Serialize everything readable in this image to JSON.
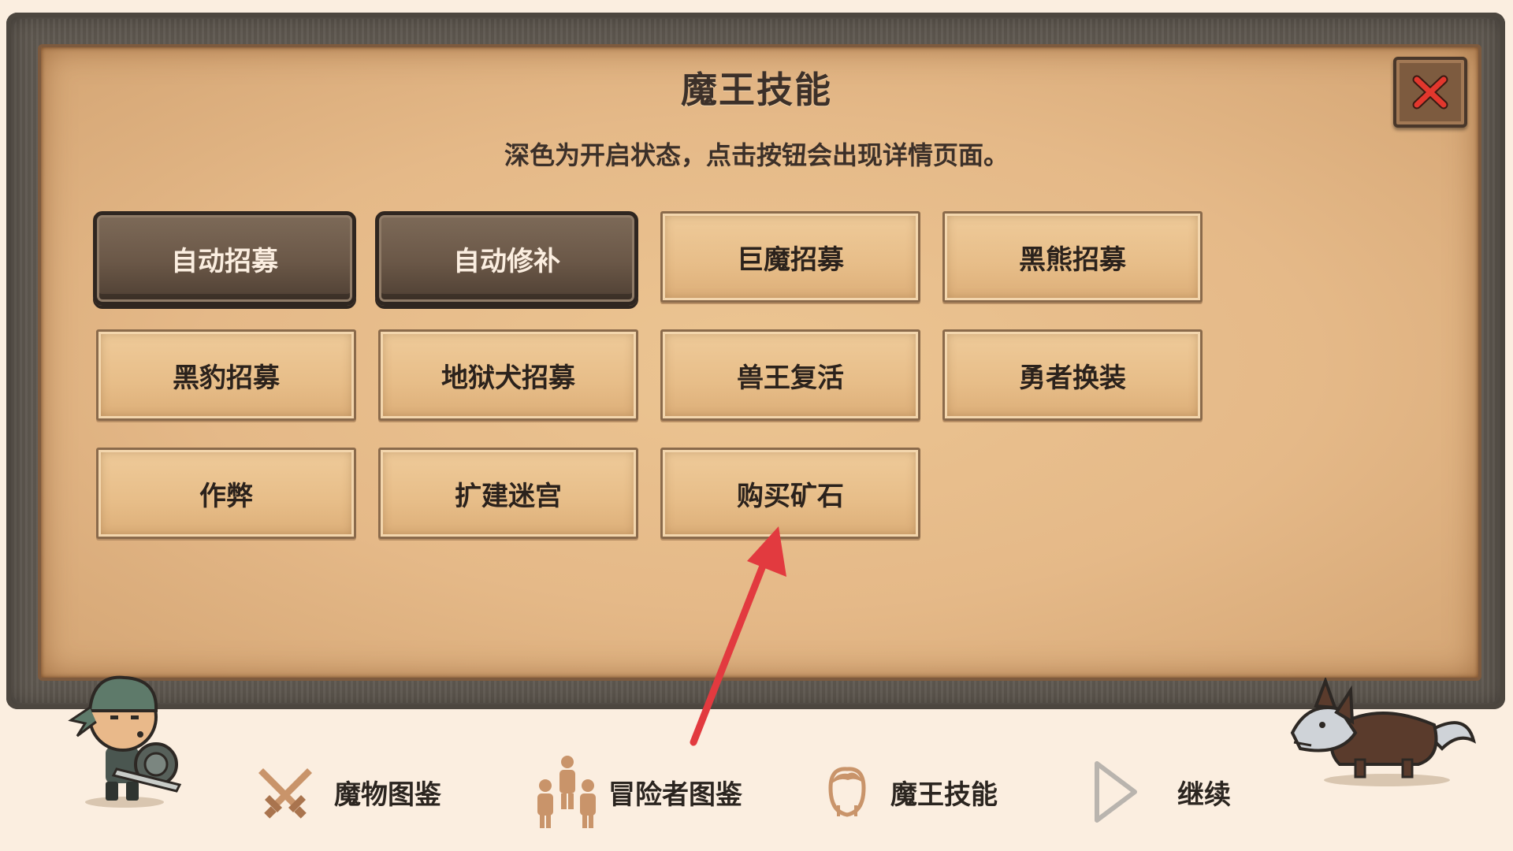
{
  "dialog": {
    "title": "魔王技能",
    "subtitle": "深色为开启状态，点击按钮会出现详情页面。",
    "close_icon": "close-x-icon"
  },
  "skills": [
    {
      "label": "自动招募",
      "enabled": true
    },
    {
      "label": "自动修补",
      "enabled": true
    },
    {
      "label": "巨魔招募",
      "enabled": false
    },
    {
      "label": "黑熊招募",
      "enabled": false
    },
    {
      "label": "黑豹招募",
      "enabled": false
    },
    {
      "label": "地狱犬招募",
      "enabled": false
    },
    {
      "label": "兽王复活",
      "enabled": false
    },
    {
      "label": "勇者换装",
      "enabled": false
    },
    {
      "label": "作弊",
      "enabled": false
    },
    {
      "label": "扩建迷宫",
      "enabled": false
    },
    {
      "label": "购买矿石",
      "enabled": false
    }
  ],
  "bottom_nav": [
    {
      "label": "魔物图鉴",
      "icon": "crossed-swords-icon"
    },
    {
      "label": "冒险者图鉴",
      "icon": "people-icon"
    },
    {
      "label": "魔王技能",
      "icon": "head-icon"
    },
    {
      "label": "继续",
      "icon": "play-icon"
    }
  ],
  "colors": {
    "accent_enabled": "#6a5747",
    "parchment": "#e5b988",
    "arrow": "#e23a3f",
    "close_x": "#e2372d"
  }
}
